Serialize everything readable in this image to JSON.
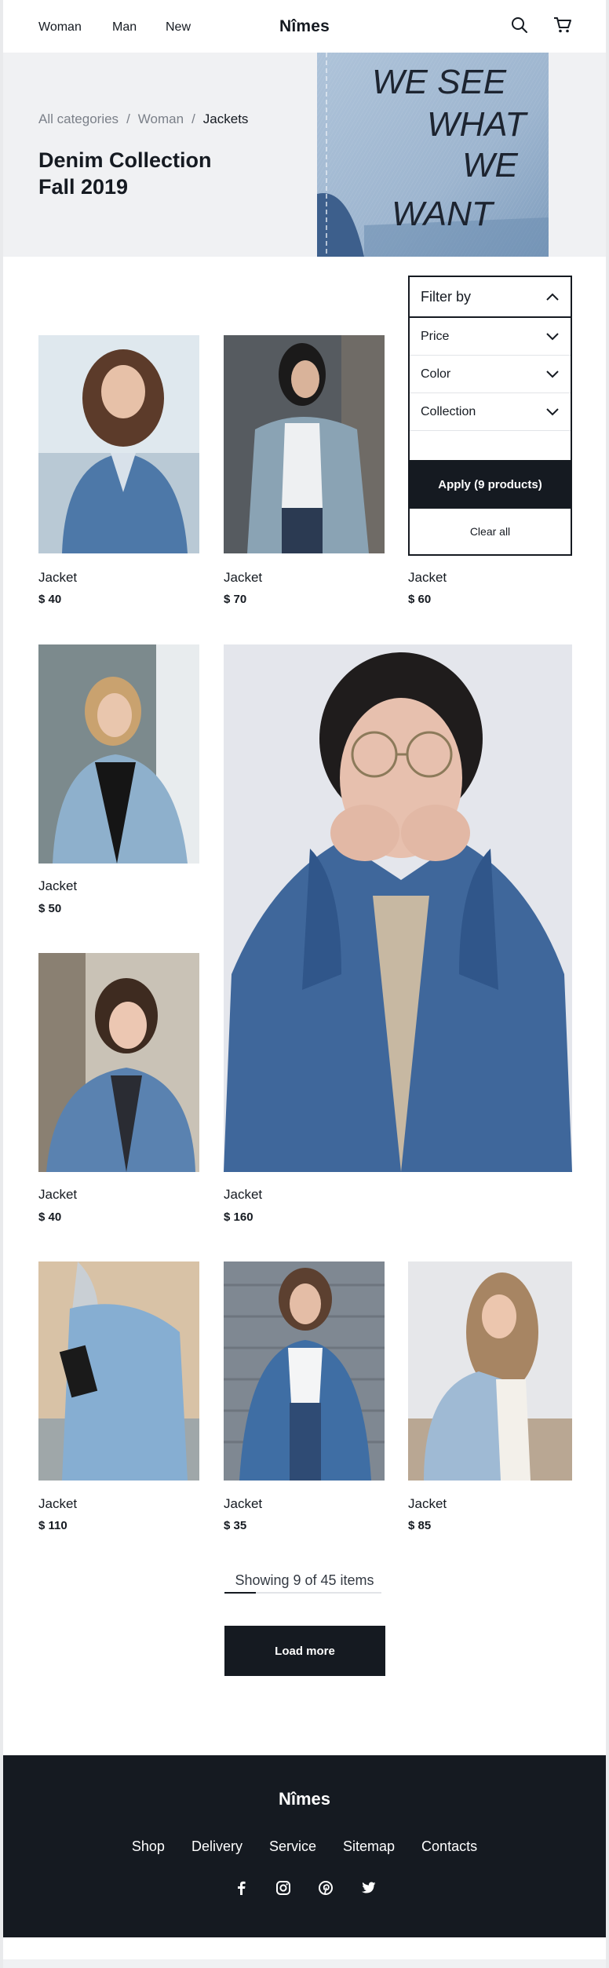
{
  "nav": {
    "links": [
      "Woman",
      "Man",
      "New"
    ],
    "brand": "Nîmes",
    "icons": [
      "search-icon",
      "cart-icon"
    ]
  },
  "hero": {
    "breadcrumb": [
      "All categories",
      "Woman",
      "Jackets"
    ],
    "title_line1": "Denim Collection",
    "title_line2": "Fall 2019",
    "patch_text": [
      "WE SEE",
      "WHAT",
      "WE",
      "WANT"
    ]
  },
  "filter": {
    "title": "Filter by",
    "options": [
      "Price",
      "Color",
      "Collection"
    ],
    "apply_label": "Apply (9 products)",
    "clear_label": "Clear all"
  },
  "products": [
    {
      "name": "Jacket",
      "price": "$ 40"
    },
    {
      "name": "Jacket",
      "price": "$ 70"
    },
    {
      "name": "Jacket",
      "price": "$ 60"
    },
    {
      "name": "Jacket",
      "price": "$ 50"
    },
    {
      "name": "Jacket",
      "price": "$ 160"
    },
    {
      "name": "Jacket",
      "price": "$ 40"
    },
    {
      "name": "Jacket",
      "price": "$ 110"
    },
    {
      "name": "Jacket",
      "price": "$ 35"
    },
    {
      "name": "Jacket",
      "price": "$ 85"
    }
  ],
  "pagination": {
    "showing_text": "Showing 9 of 45 items",
    "shown": 9,
    "total": 45,
    "load_more_label": "Load more"
  },
  "footer": {
    "brand": "Nîmes",
    "links": [
      "Shop",
      "Delivery",
      "Service",
      "Sitemap",
      "Contacts"
    ],
    "social": [
      "facebook-icon",
      "instagram-icon",
      "pinterest-icon",
      "twitter-icon"
    ]
  },
  "colors": {
    "ink": "#151a21",
    "muted": "#7b8089",
    "hero_bg": "#f0f1f3",
    "denim": "#4f78a8"
  }
}
